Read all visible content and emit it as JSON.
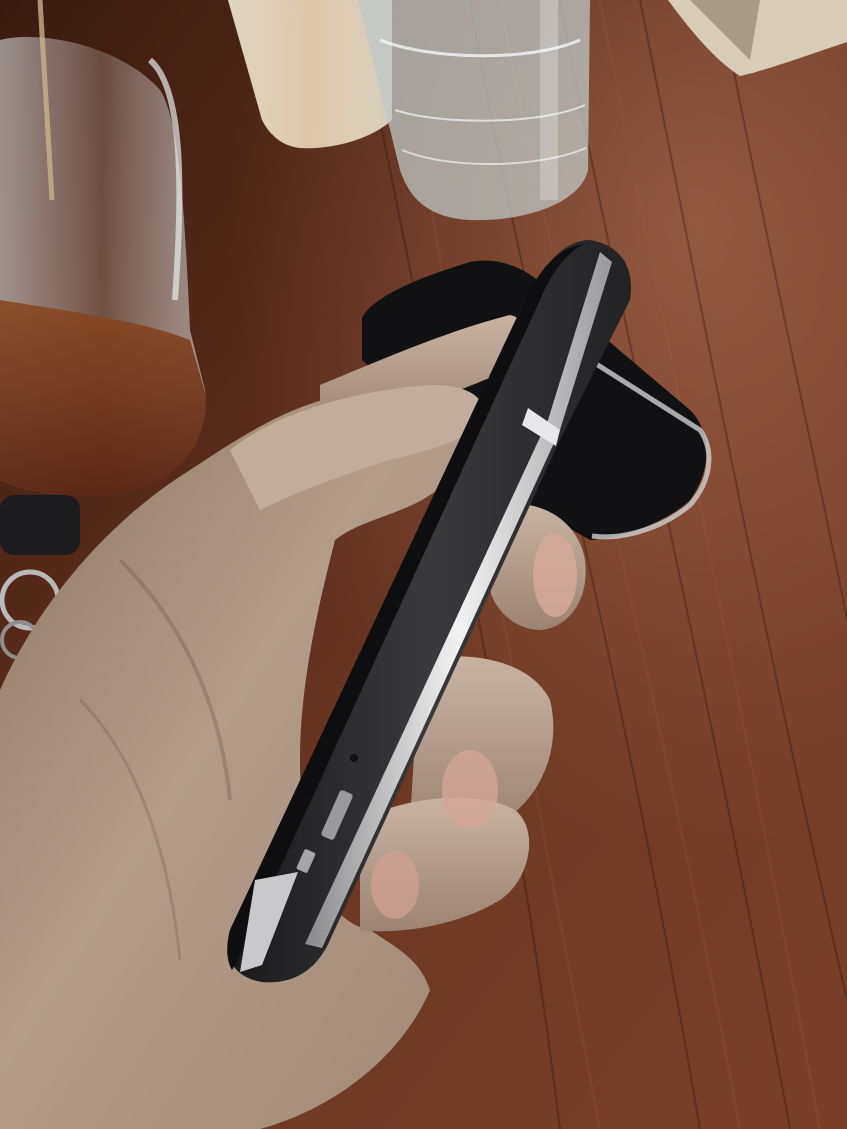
{
  "photo": {
    "subject": "hand-holding-phone-side-view",
    "colors": {
      "table_dark": "#3b1a10",
      "table_mid": "#6b3520",
      "table_light": "#8c4a2c",
      "skin_base": "#b79f8c",
      "skin_shadow": "#7e6657",
      "skin_light": "#d0bbab",
      "phone_body": "#2b2b2d",
      "phone_edge": "#111113",
      "phone_chrome": "#d4d4d6",
      "glass_tint": "#c9d1d1",
      "iced_tea": "#7a3a1a",
      "juice": "#e3c79a"
    }
  }
}
